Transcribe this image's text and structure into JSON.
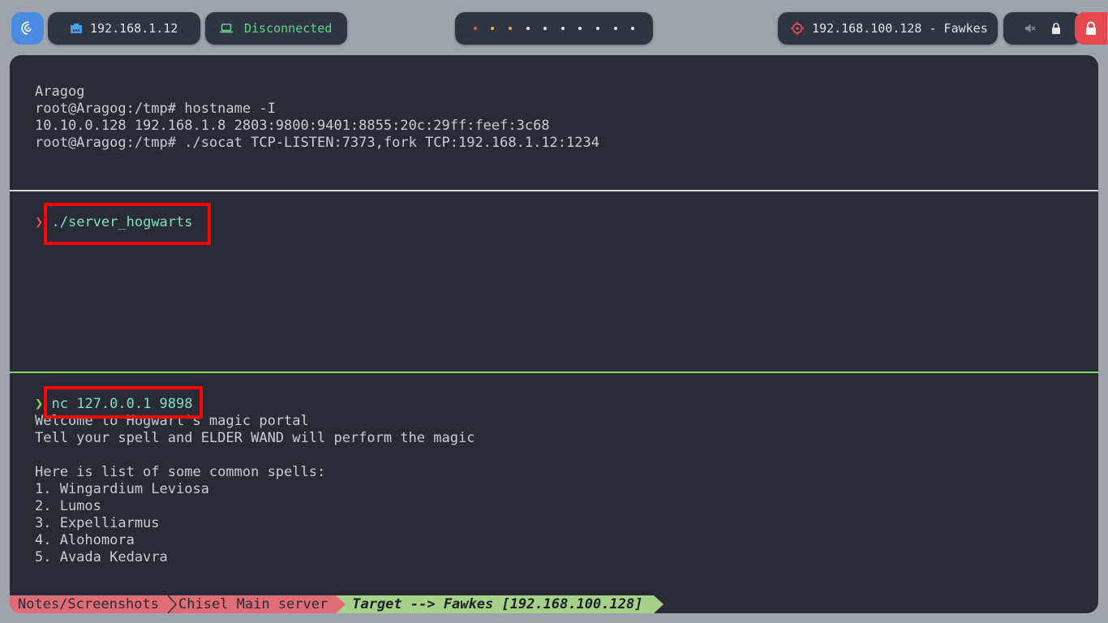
{
  "topbar": {
    "ip_label": "192.168.1.12",
    "vpn_status": "Disconnected",
    "target_label": "192.168.100.128 - Fawkes",
    "workspaces": [
      {
        "state": "active-red"
      },
      {
        "state": "occupied"
      },
      {
        "state": "occupied"
      },
      {
        "state": "empty"
      },
      {
        "state": "empty"
      },
      {
        "state": "empty"
      },
      {
        "state": "empty"
      },
      {
        "state": "empty"
      },
      {
        "state": "empty"
      },
      {
        "state": "empty"
      }
    ],
    "icons": [
      "debian-icon",
      "ethernet-icon",
      "laptop-icon",
      "target-icon",
      "mute-icon",
      "lock-icon",
      "power-lock-icon"
    ],
    "colors": {
      "accent_blue": "#4a8be0",
      "green": "#5fd38a",
      "red": "#e5484d"
    }
  },
  "pane_top": {
    "lines": [
      "Aragog",
      "root@Aragog:/tmp# hostname -I",
      "10.10.0.128 192.168.1.8 2803:9800:9401:8855:20c:29ff:feef:3c68",
      "root@Aragog:/tmp# ./socat TCP-LISTEN:7373,fork TCP:192.168.1.12:1234"
    ]
  },
  "pane_middle": {
    "prompt": "❯",
    "command": "./server_hogwarts"
  },
  "pane_bottom": {
    "prompt": "❯",
    "command": "nc 127.0.0.1 9898",
    "output": [
      "Welcome to Hogwart's magic portal",
      "Tell your spell and ELDER WAND will perform the magic",
      "",
      "Here is list of some common spells:",
      "1. Wingardium Leviosa",
      "2. Lumos",
      "3. Expelliarmus",
      "4. Alohomora",
      "5. Avada Kedavra"
    ]
  },
  "statusline": {
    "seg1": "Notes/Screenshots",
    "seg2": "Chisel Main server",
    "seg3": "Target --> Fawkes [192.168.100.128]"
  }
}
